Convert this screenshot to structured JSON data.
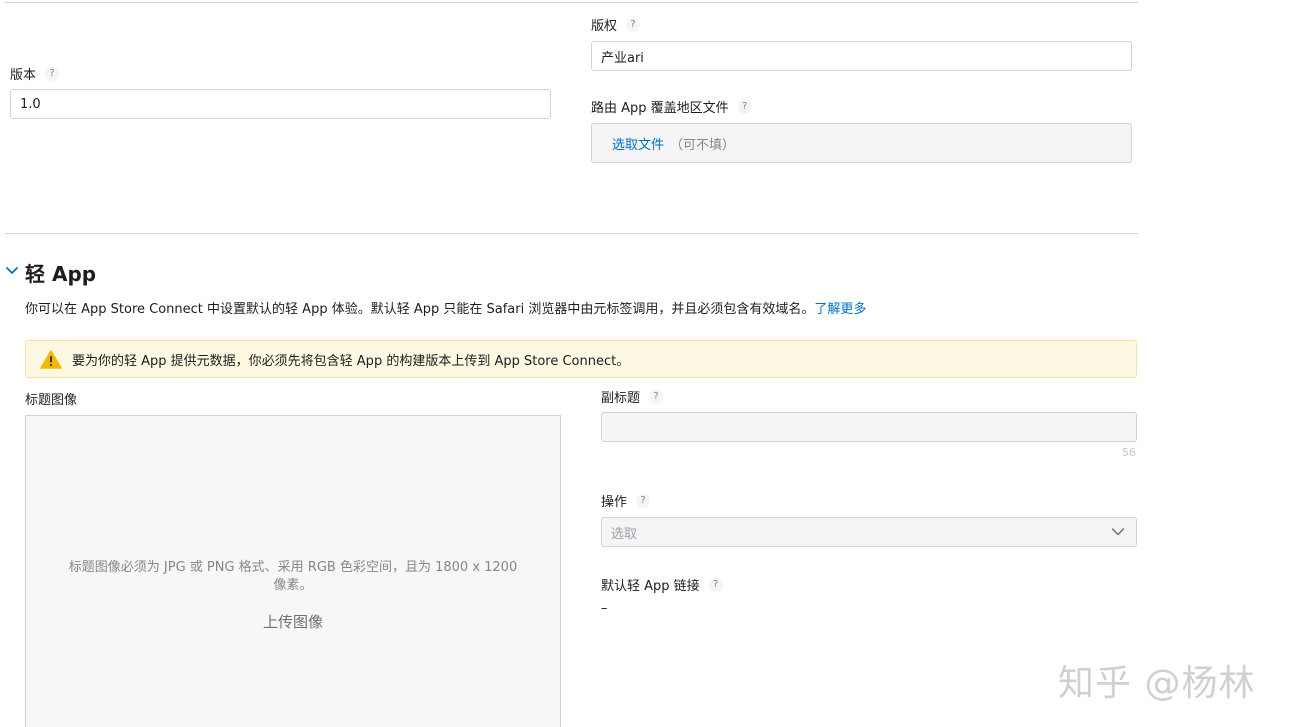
{
  "general": {
    "version_label": "版本",
    "version_value": "1.0",
    "copyright_label": "版权",
    "copyright_value": "产业ari",
    "routing_label": "路由 App 覆盖地区文件",
    "choose_file": "选取文件",
    "optional": "（可不填）",
    "help": "?"
  },
  "app_clip": {
    "title": "轻 App",
    "description": "你可以在 App Store Connect 中设置默认的轻 App 体验。默认轻 App 只能在 Safari 浏览器中由元标签调用，并且必须包含有效域名。",
    "learn_more": "了解更多",
    "warning": "要为你的轻 App 提供元数据，你必须先将包含轻 App 的构建版本上传到 App Store Connect。",
    "header_image_label": "标题图像",
    "header_image_hint": "标题图像必须为 JPG 或 PNG 格式、采用 RGB 色彩空间，且为 1800 x 1200 像素。",
    "upload_label": "上传图像",
    "subtitle_label": "副标题",
    "subtitle_value": "",
    "subtitle_counter": "56",
    "action_label": "操作",
    "action_placeholder": "选取",
    "default_link_label": "默认轻 App 链接",
    "default_link_value": "–"
  },
  "watermark": "知乎 @杨林",
  "colors": {
    "link": "#0070c9",
    "warning_bg": "#fdf8e1",
    "warning_icon": "#f5b800",
    "border": "#d2d2d7"
  }
}
